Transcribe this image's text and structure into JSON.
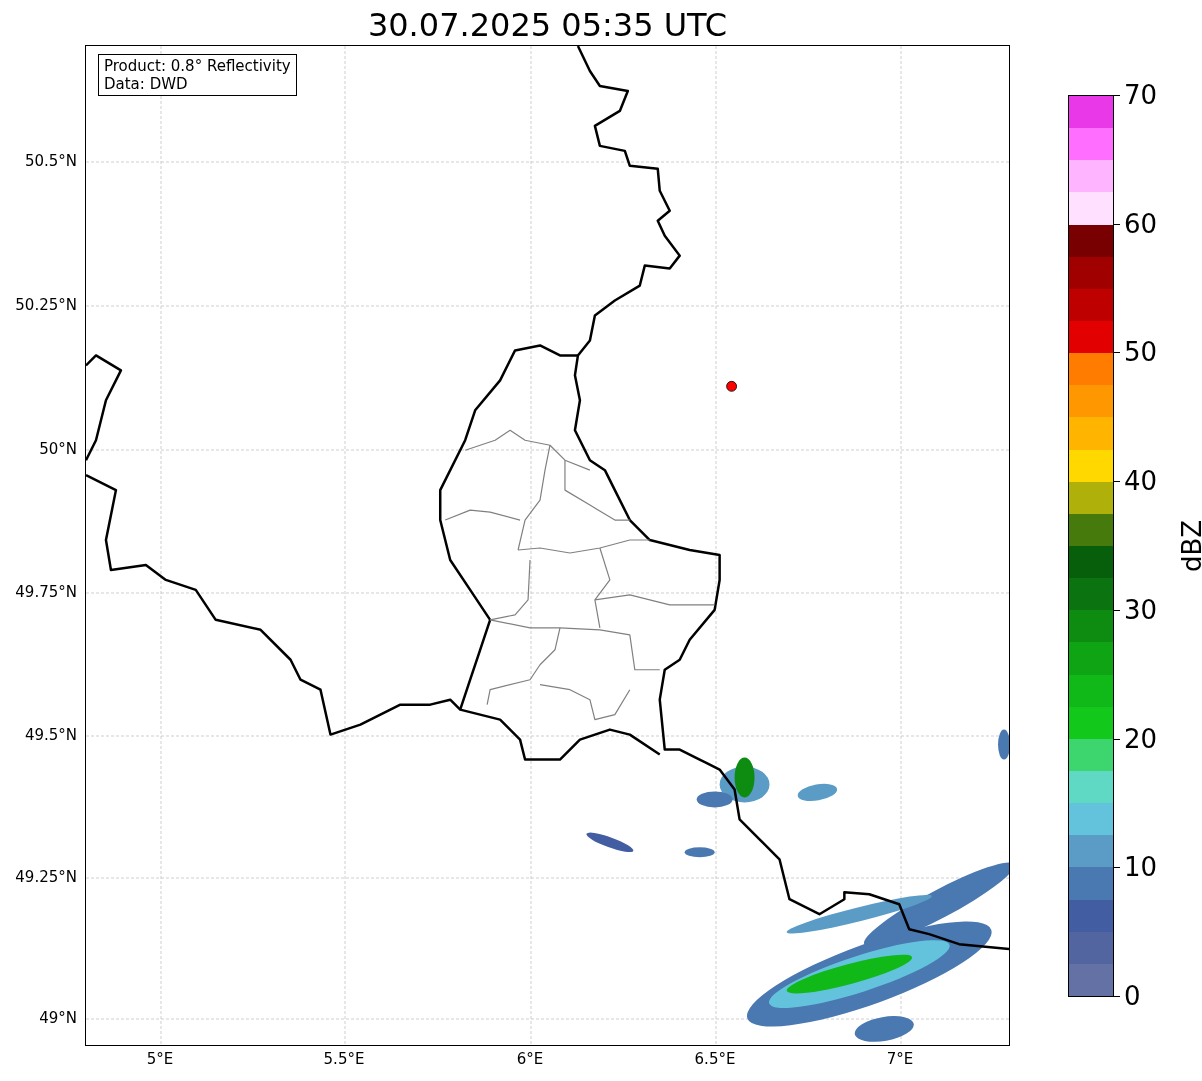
{
  "title": "30.07.2025 05:35 UTC",
  "info_box": {
    "lines": [
      "Product: 0.8° Reflectivity",
      "Data: DWD"
    ]
  },
  "map": {
    "xticks": [
      "5°E",
      "5.5°E",
      "6°E",
      "6.5°E",
      "7°E"
    ],
    "yticks": [
      "50.5°N",
      "50.25°N",
      "50°N",
      "49.75°N",
      "49.5°N",
      "49.25°N",
      "49°N"
    ]
  },
  "colorbar": {
    "label": "dBZ",
    "ticks": [
      "70",
      "60",
      "50",
      "40",
      "30",
      "20",
      "10",
      "0"
    ],
    "segments": [
      {
        "color": "#e838e8"
      },
      {
        "color": "#ff6eff"
      },
      {
        "color": "#ffb4ff"
      },
      {
        "color": "#ffe0ff"
      },
      {
        "color": "#780000"
      },
      {
        "color": "#a00000"
      },
      {
        "color": "#be0000"
      },
      {
        "color": "#e20000"
      },
      {
        "color": "#ff7c00"
      },
      {
        "color": "#ff9800"
      },
      {
        "color": "#ffb400"
      },
      {
        "color": "#ffd800"
      },
      {
        "color": "#b0b00a"
      },
      {
        "color": "#467a0c"
      },
      {
        "color": "#075f0c"
      },
      {
        "color": "#0b7410"
      },
      {
        "color": "#0e8c12"
      },
      {
        "color": "#0fa414"
      },
      {
        "color": "#10b818"
      },
      {
        "color": "#12c81a"
      },
      {
        "color": "#3dd66e"
      },
      {
        "color": "#5fd8c4"
      },
      {
        "color": "#64c3dc"
      },
      {
        "color": "#5a9cc6"
      },
      {
        "color": "#4a78b0"
      },
      {
        "color": "#435da2"
      },
      {
        "color": "#5265a0"
      },
      {
        "color": "#6371a4"
      }
    ]
  }
}
